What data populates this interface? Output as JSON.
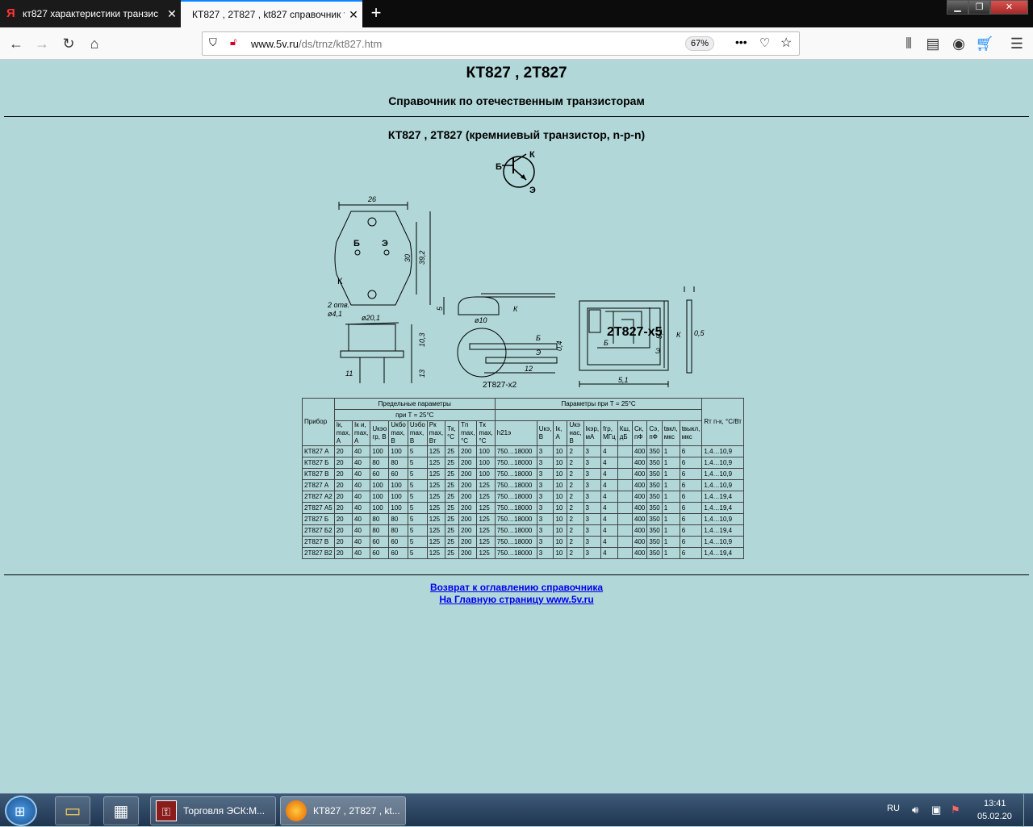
{
  "tabs": [
    {
      "title": "кт827 характеристики транзис",
      "favicon": "yandex-icon"
    },
    {
      "title": "КТ827 , 2Т827 , kt827 справочник т",
      "favicon": "none"
    }
  ],
  "toolbar": {
    "url_domain": "www.5v.ru",
    "url_path": "/ds/trnz/kt827.htm",
    "zoom": "67%"
  },
  "page": {
    "title": "КТ827 , 2Т827",
    "subtitle": "Справочник по отечественным транзисторам",
    "section_title": "КТ827 , 2Т827 (кремниевый транзистор, n-p-n)",
    "symbol_labels": {
      "k": "К",
      "b": "Б",
      "e": "Э"
    },
    "drawing_labels": {
      "dim_26": "26",
      "dim_30": "30",
      "dim_39_2": "39,2",
      "b": "Б",
      "e": "Э",
      "k": "К",
      "holes": "2 отв.",
      "hole_d": "ø4,1",
      "d_20_1": "ø20,1",
      "dim_10_3": "10,3",
      "dim_11": "11",
      "dim_13": "13",
      "dim_5": "5",
      "d_10": "ø10",
      "k2": "К",
      "b2": "Б",
      "e2": "Э",
      "dim_0_4": "0,4",
      "dim_12": "12",
      "model_x2": "2Т827-х2",
      "model_x5": "2Т827-х5",
      "b3": "Б",
      "e3": "Э",
      "dim_5_1a": "5,1",
      "dim_5_1b": "5,1",
      "dim_0_5": "0,5",
      "k3": "К"
    },
    "table": {
      "device_header": "Прибор",
      "limit_header": "Предельные параметры",
      "limit_sub": "при Т = 25°С",
      "param_header": "Параметры при Т = 25°С",
      "rt_header": "Rт п-к, °С/Вт",
      "columns": [
        "Iк, max, А",
        "Iк и, max, А",
        "Uкэо гр, В",
        "Uкбо max, В",
        "Uэбо max, В",
        "Pк max, Вт",
        "Tк, °С",
        "Tп max, °С",
        "Tк max, °С",
        "h21э",
        "Uкэ, В",
        "Iк, А",
        "Uкэ нас, В",
        "Iкэр, мА",
        "fгр, МГц",
        "Кш, дБ",
        "Ск, пФ",
        "Сэ, пФ",
        "tвкл, мкс",
        "tвыкл, мкс"
      ],
      "rows": [
        [
          "КТ827 А",
          "20",
          "40",
          "100",
          "100",
          "5",
          "125",
          "25",
          "200",
          "100",
          "750…18000",
          "3",
          "10",
          "2",
          "3",
          "4",
          "",
          "400",
          "350",
          "1",
          "6",
          "1,4…10,9"
        ],
        [
          "КТ827 Б",
          "20",
          "40",
          "80",
          "80",
          "5",
          "125",
          "25",
          "200",
          "100",
          "750…18000",
          "3",
          "10",
          "2",
          "3",
          "4",
          "",
          "400",
          "350",
          "1",
          "6",
          "1,4…10,9"
        ],
        [
          "КТ827 В",
          "20",
          "40",
          "60",
          "60",
          "5",
          "125",
          "25",
          "200",
          "100",
          "750…18000",
          "3",
          "10",
          "2",
          "3",
          "4",
          "",
          "400",
          "350",
          "1",
          "6",
          "1,4…10,9"
        ],
        [
          "2Т827 А",
          "20",
          "40",
          "100",
          "100",
          "5",
          "125",
          "25",
          "200",
          "125",
          "750…18000",
          "3",
          "10",
          "2",
          "3",
          "4",
          "",
          "400",
          "350",
          "1",
          "6",
          "1,4…10,9"
        ],
        [
          "2Т827 А2",
          "20",
          "40",
          "100",
          "100",
          "5",
          "125",
          "25",
          "200",
          "125",
          "750…18000",
          "3",
          "10",
          "2",
          "3",
          "4",
          "",
          "400",
          "350",
          "1",
          "6",
          "1,4…19,4"
        ],
        [
          "2Т827 А5",
          "20",
          "40",
          "100",
          "100",
          "5",
          "125",
          "25",
          "200",
          "125",
          "750…18000",
          "3",
          "10",
          "2",
          "3",
          "4",
          "",
          "400",
          "350",
          "1",
          "6",
          "1,4…19,4"
        ],
        [
          "2Т827 Б",
          "20",
          "40",
          "80",
          "80",
          "5",
          "125",
          "25",
          "200",
          "125",
          "750…18000",
          "3",
          "10",
          "2",
          "3",
          "4",
          "",
          "400",
          "350",
          "1",
          "6",
          "1,4…10,9"
        ],
        [
          "2Т827 Б2",
          "20",
          "40",
          "80",
          "80",
          "5",
          "125",
          "25",
          "200",
          "125",
          "750…18000",
          "3",
          "10",
          "2",
          "3",
          "4",
          "",
          "400",
          "350",
          "1",
          "6",
          "1,4…19,4"
        ],
        [
          "2Т827 В",
          "20",
          "40",
          "60",
          "60",
          "5",
          "125",
          "25",
          "200",
          "125",
          "750…18000",
          "3",
          "10",
          "2",
          "3",
          "4",
          "",
          "400",
          "350",
          "1",
          "6",
          "1,4…10,9"
        ],
        [
          "2Т827 В2",
          "20",
          "40",
          "60",
          "60",
          "5",
          "125",
          "25",
          "200",
          "125",
          "750…18000",
          "3",
          "10",
          "2",
          "3",
          "4",
          "",
          "400",
          "350",
          "1",
          "6",
          "1,4…19,4"
        ]
      ]
    },
    "links": [
      "Возврат к оглавлению справочника",
      "На Главную страницу www.5v.ru"
    ]
  },
  "taskbar": {
    "apps": [
      "Торговля ЭСК:М...",
      "КТ827 , 2Т827 , kt..."
    ],
    "lang": "RU",
    "time": "13:41",
    "date": "05.02.20"
  }
}
